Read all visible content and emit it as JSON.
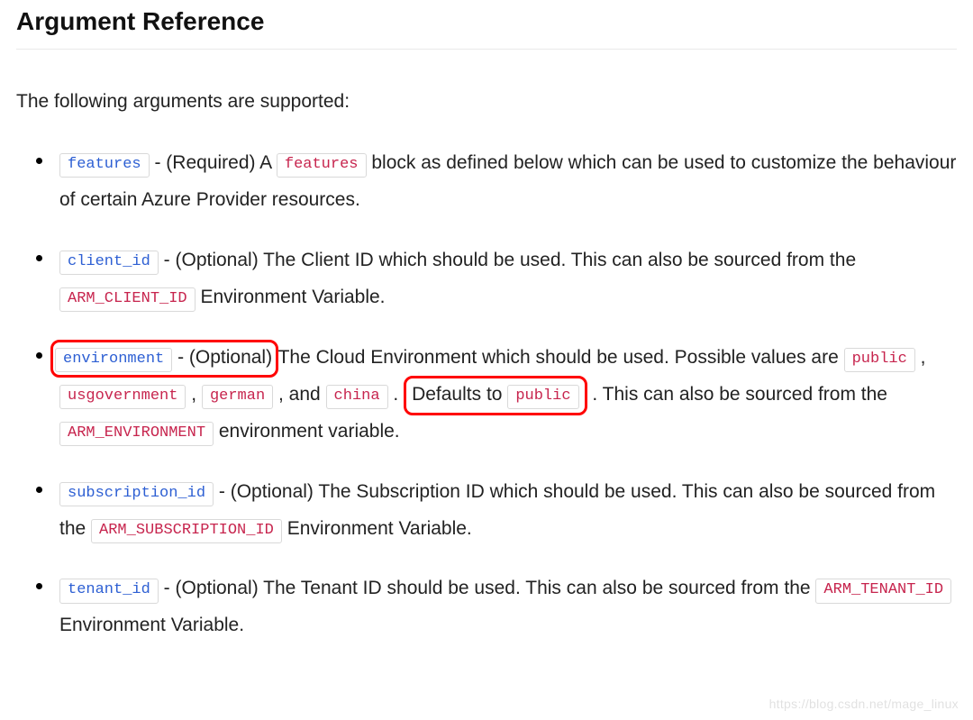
{
  "heading": "Argument Reference",
  "intro": "The following arguments are supported:",
  "args": {
    "features": {
      "name": "features",
      "seg1": " - (Required) A ",
      "inline": "features",
      "seg2": " block as defined below which can be used to customize the behaviour of certain Azure Provider resources."
    },
    "client_id": {
      "name": "client_id",
      "seg1": " - (Optional) The Client ID which should be used. This can also be sourced from the ",
      "env": "ARM_CLIENT_ID",
      "seg2": " Environment Variable."
    },
    "environment": {
      "name": "environment",
      "hl_seg": " - (Optional) ",
      "seg1": "The Cloud Environment which should be used. Possible values are ",
      "v1": "public",
      "sep1": " , ",
      "v2": "usgovernment",
      "sep2": " , ",
      "v3": "german",
      "sep3": " , and ",
      "v4": "china",
      "sep4": " . ",
      "defaults_text": "Defaults to ",
      "default_value": "public",
      "seg2": ". This can also be sourced from the ",
      "env": "ARM_ENVIRONMENT",
      "seg3": " environment variable."
    },
    "subscription_id": {
      "name": "subscription_id",
      "seg1": " - (Optional) The Subscription ID which should be used. This can also be sourced from the ",
      "env": "ARM_SUBSCRIPTION_ID",
      "seg2": " Environment Variable."
    },
    "tenant_id": {
      "name": "tenant_id",
      "seg1": " - (Optional) The Tenant ID should be used. This can also be sourced from the ",
      "env": "ARM_TENANT_ID",
      "seg2": " Environment Variable."
    }
  },
  "watermark": "https://blog.csdn.net/mage_linux"
}
